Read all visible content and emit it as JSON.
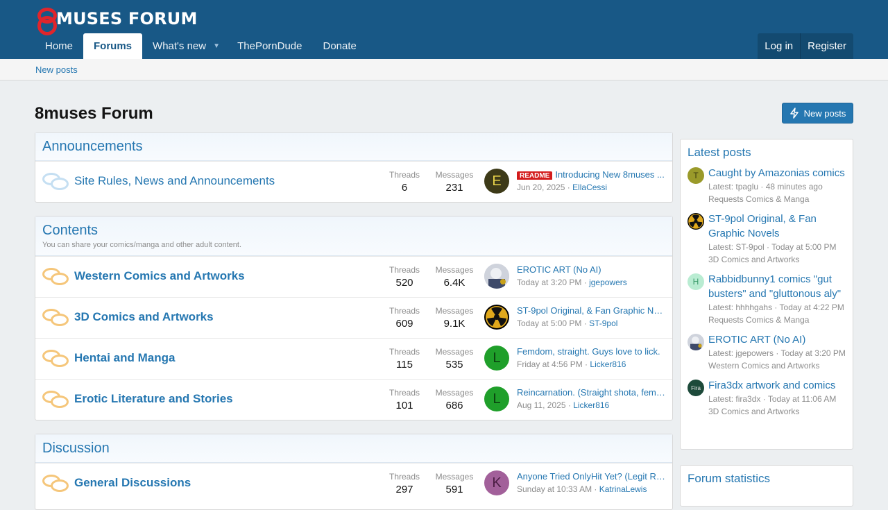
{
  "header": {
    "logo": "MUSES FORUM",
    "nav": [
      {
        "label": "Home"
      },
      {
        "label": "Forums"
      },
      {
        "label": "What's new"
      },
      {
        "label": "ThePornDude"
      },
      {
        "label": "Donate"
      }
    ],
    "login": "Log in",
    "register": "Register"
  },
  "subnav": {
    "new_posts": "New posts"
  },
  "page": {
    "title": "8muses Forum",
    "new_posts_btn": "New posts"
  },
  "labels": {
    "threads": "Threads",
    "messages": "Messages"
  },
  "announcements": {
    "title": "Announcements",
    "forums": [
      {
        "title": "Site Rules, News and Announcements",
        "threads": "6",
        "messages": "231",
        "badge": "README",
        "latest_title": "Introducing New 8muses ...",
        "latest_date": "Jun 20, 2025",
        "latest_user": "EllaCessi",
        "avatar": "E",
        "avatar_color": "#3d3a18",
        "avatar_text_color": "#e8d34a"
      }
    ]
  },
  "contents": {
    "title": "Contents",
    "description": "You can share your comics/manga and other adult content.",
    "forums": [
      {
        "title": "Western Comics and Artworks",
        "threads": "520",
        "messages": "6.4K",
        "latest_title": "EROTIC ART (No AI)",
        "latest_date": "Today at 3:20 PM",
        "latest_user": "jgepowers"
      },
      {
        "title": "3D Comics and Artworks",
        "threads": "609",
        "messages": "9.1K",
        "latest_title": "ST-9pol Original, & Fan Graphic No...",
        "latest_date": "Today at 5:00 PM",
        "latest_user": "ST-9pol"
      },
      {
        "title": "Hentai and Manga",
        "threads": "115",
        "messages": "535",
        "latest_title": "Femdom, straight. Guys love to lick.",
        "latest_date": "Friday at 4:56 PM",
        "latest_user": "Licker816",
        "avatar": "L"
      },
      {
        "title": "Erotic Literature and Stories",
        "threads": "101",
        "messages": "686",
        "latest_title": "Reincarnation. (Straight shota, femd...",
        "latest_date": "Aug 11, 2025",
        "latest_user": "Licker816",
        "avatar": "L"
      }
    ]
  },
  "discussion": {
    "title": "Discussion",
    "forums": [
      {
        "title": "General Discussions",
        "threads": "297",
        "messages": "591",
        "latest_title": "Anyone Tried OnlyHit Yet? (Legit Re...",
        "latest_date": "Sunday at 10:33 AM",
        "latest_user": "KatrinaLewis",
        "avatar": "K"
      }
    ]
  },
  "sidebar": {
    "latest_title": "Latest posts",
    "posts": [
      {
        "title": "Caught by Amazonias comics",
        "meta": "Latest: tpaglu · 48 minutes ago",
        "forum": "Requests Comics & Manga",
        "avatar": "T"
      },
      {
        "title": "ST-9pol Original, & Fan Graphic Novels",
        "meta": "Latest: ST-9pol · Today at 5:00 PM",
        "forum": "3D Comics and Artworks"
      },
      {
        "title": "Rabbidbunny1 comics \"gut busters\" and \"gluttonous aly\"",
        "meta": "Latest: hhhhgahs · Today at 4:22 PM",
        "forum": "Requests Comics & Manga",
        "avatar": "H"
      },
      {
        "title": "EROTIC ART (No AI)",
        "meta": "Latest: jgepowers · Today at 3:20 PM",
        "forum": "Western Comics and Artworks"
      },
      {
        "title": "Fira3dx artwork and comics",
        "meta": "Latest: fira3dx · Today at 11:06 AM",
        "forum": "3D Comics and Artworks",
        "avatar": "Fira"
      }
    ],
    "stats_title": "Forum statistics"
  }
}
